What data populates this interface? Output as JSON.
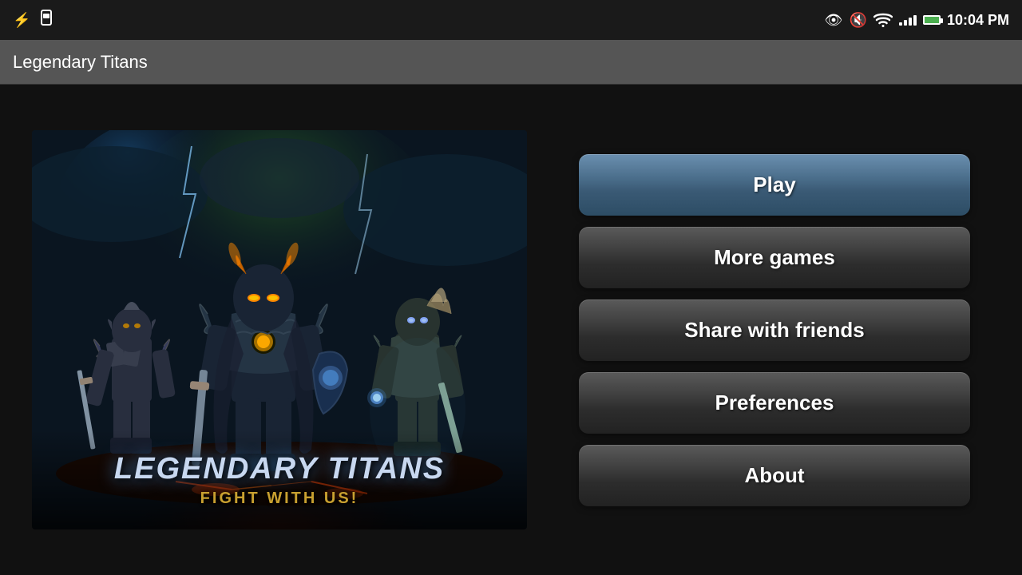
{
  "statusBar": {
    "time": "10:04 PM",
    "icons": {
      "usb": "⚡",
      "sim": "▦",
      "eye": "👁",
      "mute": "🔇",
      "wifi": "wifi",
      "signal": "signal",
      "battery": "battery"
    }
  },
  "titleBar": {
    "title": "Legendary Titans"
  },
  "gameImage": {
    "titleMain": "LEGENDARY TITANS",
    "titleSub": "FIGHT WITH US!"
  },
  "buttons": {
    "play": "Play",
    "moreGames": "More games",
    "shareWithFriends": "Share with friends",
    "preferences": "Preferences",
    "about": "About"
  },
  "colors": {
    "playButtonTop": "#6a8faf",
    "playButtonBottom": "#2d4d65",
    "menuButtonTop": "#5a5a5a",
    "menuButtonBottom": "#222"
  }
}
